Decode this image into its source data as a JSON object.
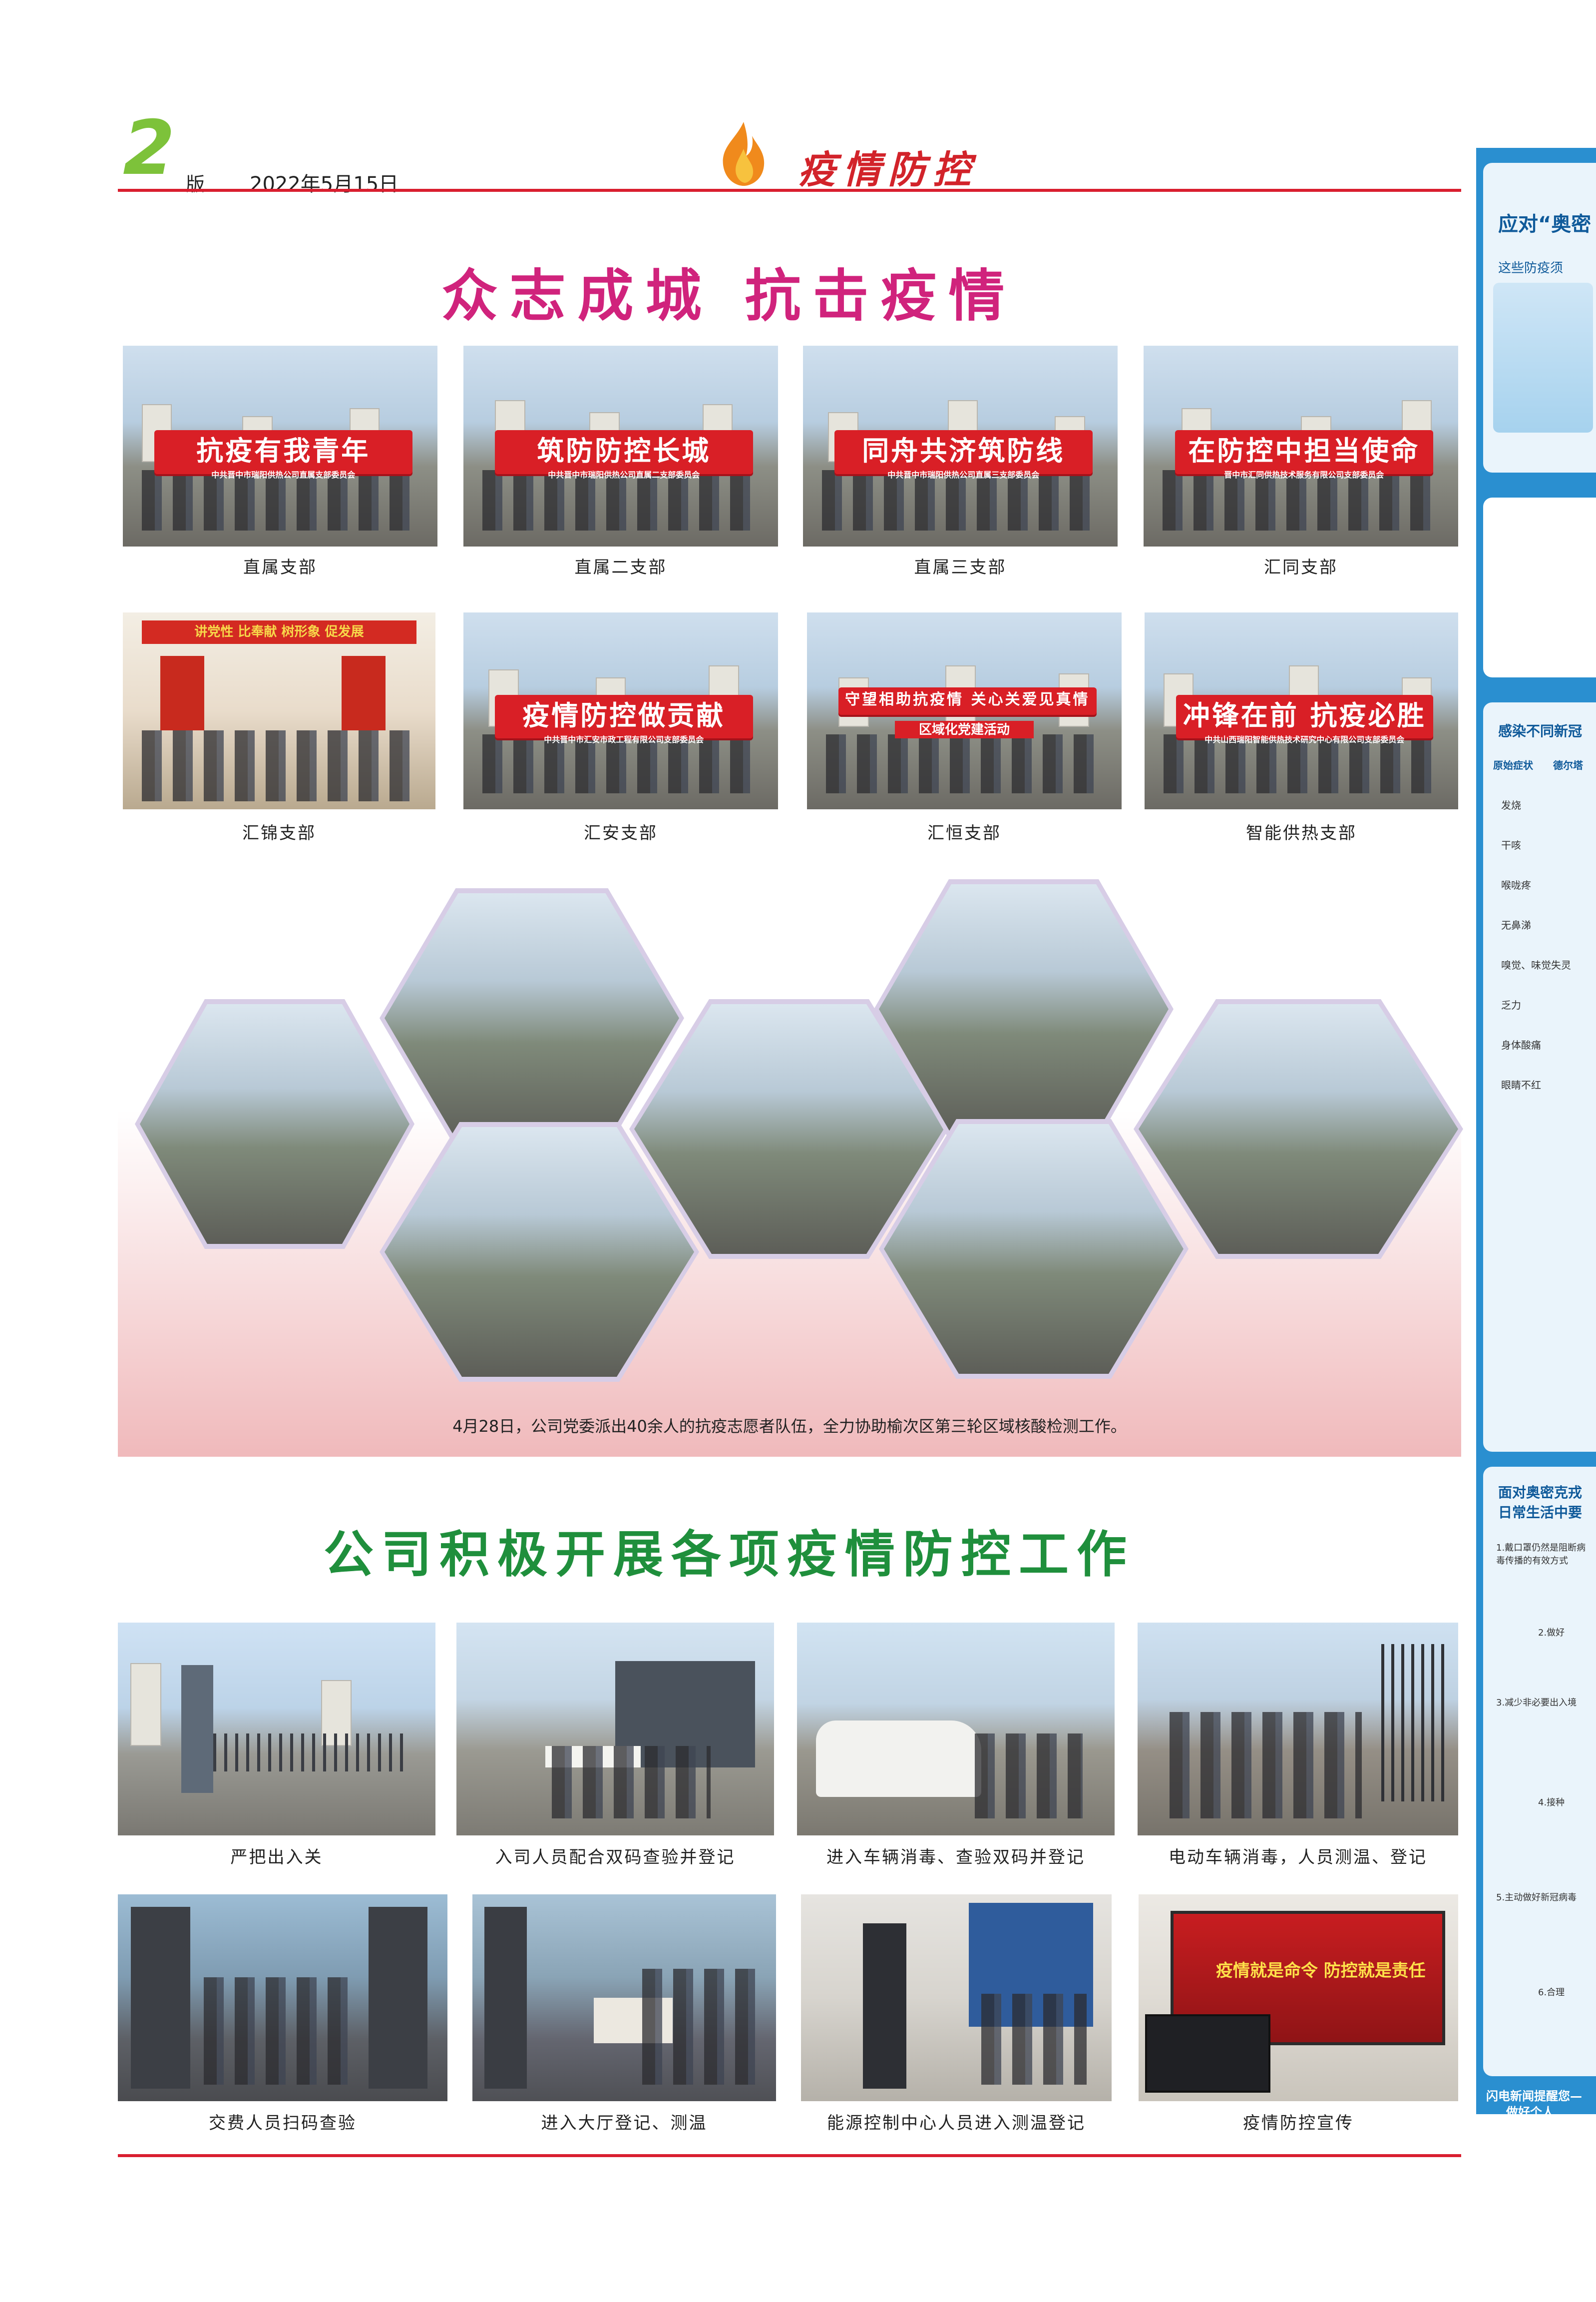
{
  "header": {
    "page_number": "2",
    "page_suffix": "版",
    "date": "2022年5月15日",
    "section": "疫情防控"
  },
  "headline1": "众志成城  抗击疫情",
  "branch_photos": [
    {
      "banner": "抗疫有我青年",
      "sub": "中共晋中市瑞阳供热公司直属支部委员会",
      "caption": "直属支部"
    },
    {
      "banner": "筑防防控长城",
      "sub": "中共晋中市瑞阳供热公司直属二支部委员会",
      "caption": "直属二支部"
    },
    {
      "banner": "同舟共济筑防线",
      "sub": "中共晋中市瑞阳供热公司直属三支部委员会",
      "caption": "直属三支部"
    },
    {
      "banner": "在防控中担当使命",
      "sub": "晋中市汇同供热技术服务有限公司支部委员会",
      "caption": "汇同支部"
    },
    {
      "banner": "讲党性 比奉献 树形象 促发展",
      "sub": "",
      "caption": "汇锦支部"
    },
    {
      "banner": "疫情防控做贡献",
      "sub": "中共晋中市汇安市政工程有限公司支部委员会",
      "caption": "汇安支部"
    },
    {
      "banner": "守望相助抗疫情 关心关爱见真情",
      "sub": "区域化党建活动",
      "caption": "汇恒支部"
    },
    {
      "banner": "冲锋在前 抗疫必胜",
      "sub": "中共山西瑞阳智能供热技术研究中心有限公司支部委员会",
      "caption": "智能供热支部"
    }
  ],
  "collage_caption": "4月28日，公司党委派出40余人的抗疫志愿者队伍，全力协助榆次区第三轮区域核酸检测工作。",
  "headline2": "公司积极开展各项疫情防控工作",
  "work_photos": [
    {
      "caption": "严把出入关"
    },
    {
      "caption": "入司人员配合双码查验并登记"
    },
    {
      "caption": "进入车辆消毒、查验双码并登记"
    },
    {
      "caption": "电动车辆消毒，人员测温、登记"
    },
    {
      "caption": "交费人员扫码查验"
    },
    {
      "caption": "进入大厅登记、测温"
    },
    {
      "caption": "能源控制中心人员进入测温登记"
    },
    {
      "caption": "疫情防控宣传",
      "screen": "疫情就是命令  防控就是责任"
    }
  ],
  "sidebar": {
    "title1": "应对“奥密",
    "subtitle1": "这些防疫须",
    "title2": "感染不同新冠",
    "col_a": "原始症状",
    "col_b": "德尔塔",
    "symptoms": [
      "发烧",
      "干咳",
      "喉咙疼",
      "无鼻涕",
      "嗅觉、味觉失灵",
      "乏力",
      "身体酸痛",
      "眼睛不红"
    ],
    "title3": "面对奥密克戎",
    "title3b": "日常生活中要",
    "tips": [
      "1.戴口罩仍然是阻断病毒传播的有效方式",
      "2.做好",
      "3.减少非必要出入境",
      "4.接种",
      "5.主动做好新冠病毒",
      "6.合理"
    ],
    "footer1": "闪电新闻提醒您—",
    "footer2": "做好个人"
  },
  "colors": {
    "accent_red": "#d91e2f",
    "headline_pink": "#d0237c",
    "headline_green": "#1f8f3c",
    "sidebar_blue": "#2a8fd0"
  }
}
